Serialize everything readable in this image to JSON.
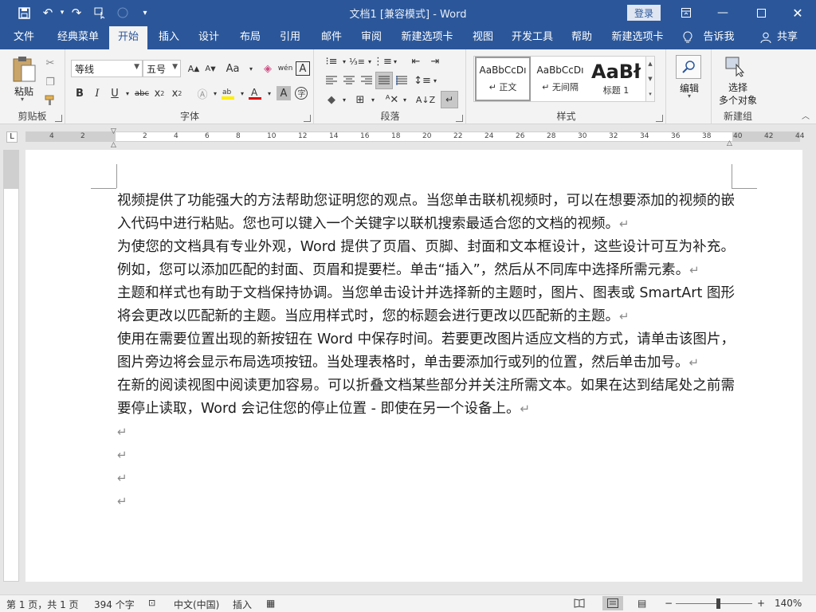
{
  "window": {
    "title": "文档1 [兼容模式]  -  Word",
    "login": "登录",
    "controls": [
      "restore-ribbon",
      "minimize",
      "maximize",
      "close"
    ]
  },
  "qat": [
    "save-icon",
    "undo-icon",
    "redo-icon",
    "touch-mode-icon",
    "circle-icon",
    "customize-qat-icon"
  ],
  "tabs": [
    "文件",
    "经典菜单",
    "开始",
    "插入",
    "设计",
    "布局",
    "引用",
    "邮件",
    "审阅",
    "新建选项卡",
    "视图",
    "开发工具",
    "帮助",
    "新建选项卡"
  ],
  "active_tab": "开始",
  "tell_me": "告诉我",
  "share": "共享",
  "ribbon": {
    "clipboard": {
      "paste": "粘贴",
      "label": "剪贴板"
    },
    "font": {
      "name": "等线",
      "size": "五号",
      "label": "字体"
    },
    "paragraph": {
      "label": "段落"
    },
    "styles": {
      "items": [
        {
          "preview": "AaBbCcDı",
          "name": "↵ 正文"
        },
        {
          "preview": "AaBbCcDı",
          "name": "↵ 无间隔"
        },
        {
          "preview": "AaBł",
          "name": "标题 1"
        }
      ],
      "label": "样式"
    },
    "editing": {
      "label": "编辑"
    },
    "new_group": {
      "select": "选择",
      "multiple": "多个对象",
      "label": "新建组"
    }
  },
  "ruler": {
    "numbers": [
      "4",
      "2",
      "2",
      "4",
      "6",
      "8",
      "10",
      "12",
      "14",
      "16",
      "18",
      "20",
      "22",
      "24",
      "26",
      "28",
      "30",
      "32",
      "34",
      "36",
      "38",
      "40",
      "42",
      "44"
    ],
    "corner": "L"
  },
  "document": {
    "paragraphs": [
      "视频提供了功能强大的方法帮助您证明您的观点。当您单击联机视频时，可以在想要添加的视频的嵌入代码中进行粘贴。您也可以键入一个关键字以联机搜索最适合您的文档的视频。",
      "为使您的文档具有专业外观，Word 提供了页眉、页脚、封面和文本框设计，这些设计可互为补充。例如，您可以添加匹配的封面、页眉和提要栏。单击“插入”，然后从不同库中选择所需元素。",
      "主题和样式也有助于文档保持协调。当您单击设计并选择新的主题时，图片、图表或 SmartArt 图形将会更改以匹配新的主题。当应用样式时，您的标题会进行更改以匹配新的主题。",
      "使用在需要位置出现的新按钮在 Word 中保存时间。若要更改图片适应文档的方式，请单击该图片，图片旁边将会显示布局选项按钮。当处理表格时，单击要添加行或列的位置，然后单击加号。",
      "在新的阅读视图中阅读更加容易。可以折叠文档某些部分并关注所需文本。如果在达到结尾处之前需要停止读取，Word 会记住您的停止位置 - 即使在另一个设备上。"
    ],
    "paragraph_mark": "↵",
    "empty_lines": 4
  },
  "status": {
    "page": "第 1 页，共 1 页",
    "words": "394 个字",
    "language": "中文(中国)",
    "mode": "插入",
    "zoom": "140%",
    "zoom_minus": "−",
    "zoom_plus": "+"
  },
  "colors": {
    "accent": "#2b579a",
    "ribbon_bg": "#f3f3f3",
    "spell_underline": "#2b6fd6"
  }
}
